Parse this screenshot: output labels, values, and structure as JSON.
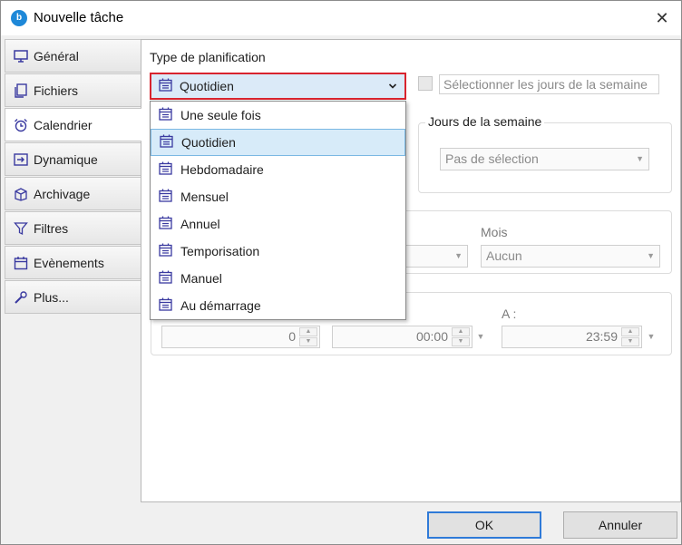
{
  "window": {
    "title": "Nouvelle tâche",
    "app_icon_glyph": "b",
    "close_glyph": "✕"
  },
  "tabs": [
    {
      "label": "Général",
      "icon": "monitor-icon"
    },
    {
      "label": "Fichiers",
      "icon": "copy-files-icon"
    },
    {
      "label": "Calendrier",
      "icon": "alarm-clock-icon"
    },
    {
      "label": "Dynamique",
      "icon": "enter-arrow-icon"
    },
    {
      "label": "Archivage",
      "icon": "archive-box-icon"
    },
    {
      "label": "Filtres",
      "icon": "funnel-icon"
    },
    {
      "label": "Evènements",
      "icon": "calendar-icon"
    },
    {
      "label": "Plus...",
      "icon": "wrench-icon"
    }
  ],
  "active_tab": "Calendrier",
  "schedule": {
    "type_label": "Type de planification",
    "selected": "Quotidien",
    "options": [
      "Une seule fois",
      "Quotidien",
      "Hebdomadaire",
      "Mensuel",
      "Annuel",
      "Temporisation",
      "Manuel",
      "Au démarrage"
    ]
  },
  "weekdays": {
    "checkbox_label": "Sélectionner les jours de la semaine",
    "group_title": "Jours de la semaine",
    "select_value": "Pas de sélection"
  },
  "month": {
    "label": "Mois",
    "value": "Aucun"
  },
  "time": {
    "count_value": "0",
    "start_value": "00:00",
    "end_label": "A :",
    "end_value": "23:59"
  },
  "buttons": {
    "ok": "OK",
    "cancel": "Annuler"
  },
  "colors": {
    "highlight_border": "#d8242e",
    "selection_bg": "#d7ebf9",
    "accent": "#2f7ad8"
  }
}
